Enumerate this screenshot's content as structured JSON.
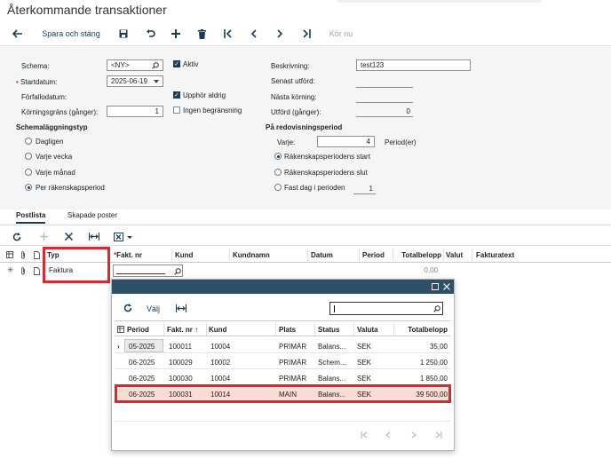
{
  "page": {
    "title": "Återkommande transaktioner"
  },
  "toolbar": {
    "back_icon": "arrow-left-icon",
    "save_close_label": "Spara och stäng",
    "run_now_label": "Kör nu"
  },
  "form": {
    "schema_label": "Schema:",
    "schema_value": "<NY>",
    "active_label": "Aktiv",
    "startdate_label": "Startdatum:",
    "startdate_value": "2025-06-19",
    "duedate_label": "Förfallodatum:",
    "never_expires_label": "Upphör aldrig",
    "run_limit_label": "Körningsgräns (gånger):",
    "run_limit_value": "1",
    "no_limit_label": "Ingen begränsning",
    "description_label": "Beskrivning:",
    "description_value": "test123",
    "last_run_label": "Senast utförd:",
    "next_run_label": "Nästa körning:",
    "executed_label": "Utförd (gånger):",
    "executed_value": "0",
    "schedule_type_label": "Schemaläggningstyp",
    "schedule_options": [
      "Dagligen",
      "Varje vecka",
      "Varje månad",
      "Per räkenskapsperiod"
    ],
    "schedule_selected": 3,
    "fiscal_period_label": "På redovisningsperiod",
    "every_label": "Varje:",
    "every_value": "4",
    "period_unit_label": "Period(er)",
    "period_options": [
      "Räkenskapsperiodens start",
      "Räkenskapsperiodens slut",
      "Fast dag i perioden"
    ],
    "period_selected": 0,
    "fixed_day_value": "1"
  },
  "tabs": [
    "Postlista",
    "Skapade poster"
  ],
  "grid": {
    "columns": [
      "Typ",
      "Fakt. nr",
      "Kund",
      "Kundnamn",
      "Datum",
      "Period",
      "Totalbelopp",
      "Valut",
      "Fakturatext"
    ],
    "rows": [
      {
        "typ": "Faktura",
        "total": "0,00"
      }
    ]
  },
  "popup": {
    "select_label": "Välj",
    "search_value": "",
    "columns": [
      "Period",
      "Fakt. nr",
      "Kund",
      "Plats",
      "Status",
      "Valuta",
      "Totalbelopp"
    ],
    "rows": [
      {
        "period": "05-2025",
        "fakt": "100011",
        "kund": "10004",
        "plats": "PRIMÄR",
        "status": "Balans...",
        "valuta": "SEK",
        "total": "35,00"
      },
      {
        "period": "06-2025",
        "fakt": "100029",
        "kund": "10002",
        "plats": "PRIMÄR",
        "status": "Schem...",
        "valuta": "SEK",
        "total": "1 250,00"
      },
      {
        "period": "06-2025",
        "fakt": "100030",
        "kund": "10004",
        "plats": "PRIMÄR",
        "status": "Balans...",
        "valuta": "SEK",
        "total": "1 850,00"
      },
      {
        "period": "06-2025",
        "fakt": "100031",
        "kund": "10014",
        "plats": "MAIN",
        "status": "Balans...",
        "valuta": "SEK",
        "total": "39 500,00"
      }
    ]
  },
  "colors": {
    "accent": "#1f3a52",
    "highlight": "#f9ddd4",
    "red": "#d9292c",
    "popup_title": "#2e5067"
  }
}
